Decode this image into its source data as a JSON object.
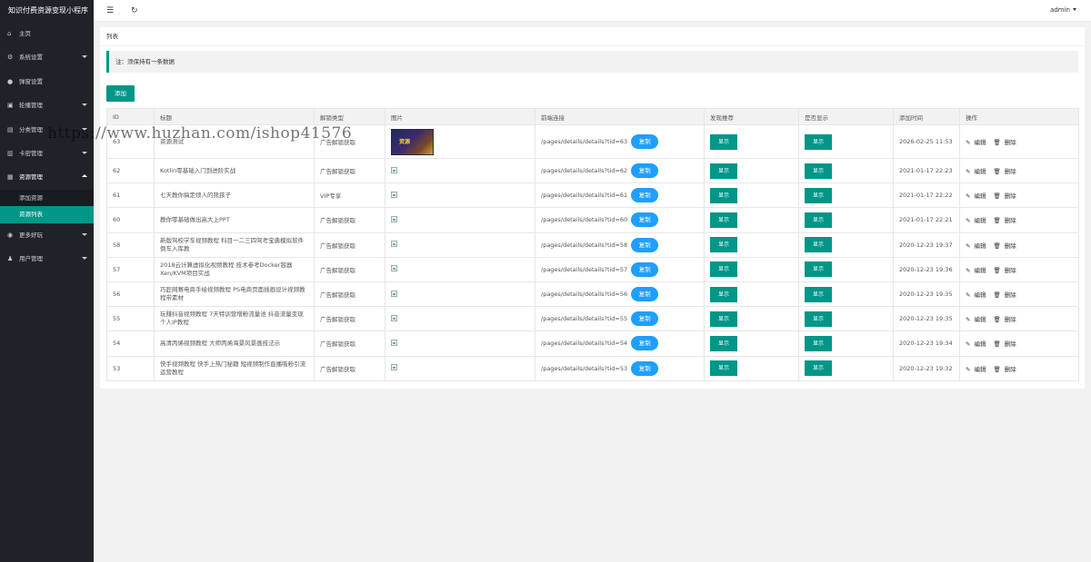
{
  "brand": "知识付费资源变现小程序",
  "sidebar": {
    "items": [
      {
        "label": "主页",
        "icon": "home-icon",
        "glyph": "⌂"
      },
      {
        "label": "系统设置",
        "icon": "gear-icon",
        "glyph": "⚙"
      },
      {
        "label": "弹窗设置",
        "icon": "dot-icon",
        "glyph": "●"
      },
      {
        "label": "轮播管理",
        "icon": "carousel-icon",
        "glyph": "▣"
      },
      {
        "label": "分类管理",
        "icon": "category-icon",
        "glyph": "▤"
      },
      {
        "label": "卡密管理",
        "icon": "card-icon",
        "glyph": "▥"
      },
      {
        "label": "资源管理",
        "icon": "resource-icon",
        "glyph": "▦"
      },
      {
        "label": "更多好玩",
        "icon": "play-icon",
        "glyph": "◉"
      },
      {
        "label": "用户管理",
        "icon": "user-icon",
        "glyph": "♟"
      }
    ],
    "sub_items": [
      {
        "label": "添加资源"
      },
      {
        "label": "资源列表"
      }
    ]
  },
  "header": {
    "user": "admin"
  },
  "card": {
    "title": "列表",
    "notice": "注：须保持有一条数据",
    "add_label": "添加"
  },
  "table": {
    "columns": [
      "ID",
      "标题",
      "解锁类型",
      "图片",
      "前端连接",
      "发现推荐",
      "是否显示",
      "添加时间",
      "操作"
    ],
    "copy_label": "复制",
    "show_label": "显示",
    "edit_label": "编辑",
    "delete_label": "删除",
    "thumb_text": "资源",
    "rows": [
      {
        "id": "63",
        "title": "资源测试",
        "unlock": "广告解锁获取",
        "link": "/pages/details/details?tid=63",
        "time": "2026-02-25 11:53"
      },
      {
        "id": "62",
        "title": "Kotlin零基础入门到进阶实战",
        "unlock": "广告解锁获取",
        "link": "/pages/details/details?tid=62",
        "time": "2021-01-17 22:23"
      },
      {
        "id": "61",
        "title": "七天教你搞定烦人的熊孩子",
        "unlock": "VIP专享",
        "link": "/pages/details/details?tid=61",
        "time": "2021-01-17 22:22"
      },
      {
        "id": "60",
        "title": "教你零基础做出高大上PPT",
        "unlock": "广告解锁获取",
        "link": "/pages/details/details?tid=60",
        "time": "2021-01-17 22:21"
      },
      {
        "id": "58",
        "title": "新版驾校学车视频教程 科目一二三四驾考宝典模拟软件倒车入库教",
        "unlock": "广告解锁获取",
        "link": "/pages/details/details?tid=58",
        "time": "2020-12-23 19:37"
      },
      {
        "id": "57",
        "title": "2018云计算虚拟化视频教程 技术参考Docker容器Xen/KVM项目实战",
        "unlock": "广告解锁获取",
        "link": "/pages/details/details?tid=57",
        "time": "2020-12-23 19:36"
      },
      {
        "id": "56",
        "title": "巧匠网赛电商手绘视频教程 PS电商页面插画设计视频教程带素材",
        "unlock": "广告解锁获取",
        "link": "/pages/details/details?tid=56",
        "time": "2020-12-23 19:35"
      },
      {
        "id": "55",
        "title": "玩赚抖音视频教程 7天特训营增粉流量池 抖音流量变现个人IP教程",
        "unlock": "广告解锁获取",
        "link": "/pages/details/details?tid=55",
        "time": "2020-12-23 19:35"
      },
      {
        "id": "54",
        "title": "高清丙烯视频教程 大师丙烯海景风景画技法示",
        "unlock": "广告解锁获取",
        "link": "/pages/details/details?tid=54",
        "time": "2020-12-23 19:34"
      },
      {
        "id": "53",
        "title": "快手视频教程 快手上热门秘籍 短视频制作直播吸粉引流运营教程",
        "unlock": "广告解锁获取",
        "link": "/pages/details/details?tid=53",
        "time": "2020-12-23 19:32"
      }
    ]
  },
  "watermark": "https://www.huzhan.com/ishop41576"
}
